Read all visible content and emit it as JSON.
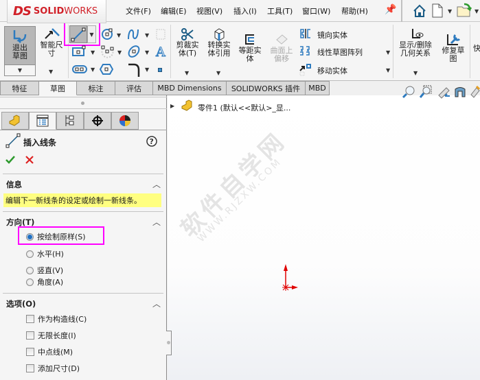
{
  "app": {
    "brand_mark": "DS",
    "brand_name_bold": "SOLID",
    "brand_name_light": "WORKS"
  },
  "menu": [
    "文件(F)",
    "编辑(E)",
    "视图(V)",
    "插入(I)",
    "工具(T)",
    "窗口(W)",
    "帮助(H)"
  ],
  "toolbar": {
    "exit_sketch": "退出草图",
    "smart_dim": "智能尺寸",
    "trim": "剪裁实体(T)",
    "convert": "转换实体引用",
    "offset": "等距实体",
    "surface_offset": "曲面上偏移",
    "mirror": "镜向实体",
    "linear_pattern": "线性草图阵列",
    "move": "移动实体",
    "display_delete": "显示/删除几何关系",
    "repair": "修复草图",
    "quick": "快"
  },
  "tabs": [
    "特征",
    "草图",
    "标注",
    "评估",
    "MBD Dimensions",
    "SOLIDWORKS 插件",
    "MBD"
  ],
  "active_tab": "草图",
  "panel": {
    "title": "插入线条",
    "info_header": "信息",
    "info_text": "编辑下一新线条的设定或绘制一新线条。",
    "direction_header": "方向(T)",
    "direction_options": [
      "按绘制原样(S)",
      "水平(H)",
      "竖直(V)",
      "角度(A)"
    ],
    "direction_selected": "按绘制原样(S)",
    "options_header": "选项(O)",
    "options": [
      "作为构造线(C)",
      "无限长度(I)",
      "中点线(M)",
      "添加尺寸(D)"
    ]
  },
  "tree": {
    "part_label": "零件1  (默认<<默认>_显..."
  },
  "watermark": {
    "cn": "软件自学网",
    "url": "WWW.RJZXW.COM"
  },
  "colors": {
    "highlight": "#ff00ff",
    "info_bg": "#ffff80",
    "origin": "#e00000"
  }
}
